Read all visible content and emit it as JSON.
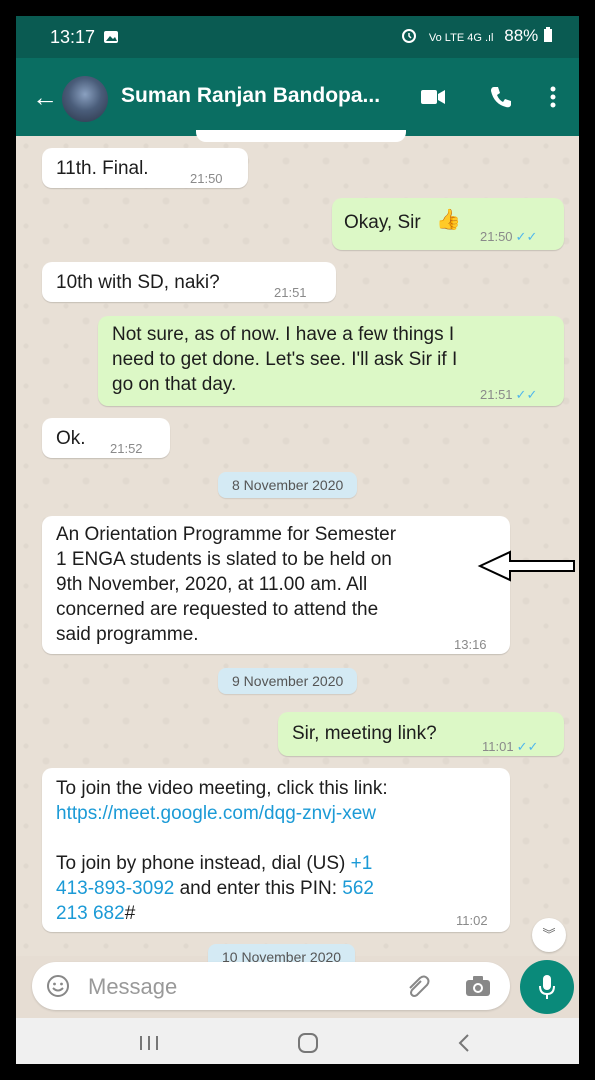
{
  "status": {
    "time": "13:17",
    "indicators": "88%",
    "image_icon": "image-icon"
  },
  "header": {
    "contact_name": "Suman Ranjan Bandopa...",
    "back_icon": "arrow-left-icon",
    "video_icon": "video-icon",
    "call_icon": "phone-icon",
    "menu_icon": "more-vert-icon"
  },
  "messages": [
    {
      "dir": "in",
      "text": "11th. Final.",
      "time": "21:50"
    },
    {
      "dir": "out",
      "text": "Okay, Sir",
      "emoji": "👍",
      "time": "21:50"
    },
    {
      "dir": "in",
      "text": "10th with SD, naki?",
      "time": "21:51"
    },
    {
      "dir": "out",
      "lines": [
        "Not sure, as of now. I have a few things I",
        "need to get done. Let's see. I'll ask Sir if I",
        "go on that day."
      ],
      "time": "21:51"
    },
    {
      "dir": "in",
      "text": "Ok.",
      "time": "21:52"
    },
    {
      "dir": "in",
      "lines": [
        "An Orientation Programme for Semester",
        "1 ENGA students is slated to be held on",
        "9th November, 2020, at 11.00 am. All",
        "concerned are requested to attend the",
        "said programme."
      ],
      "time": "13:16"
    },
    {
      "dir": "out",
      "text": "Sir, meeting link?",
      "time": "11:01"
    },
    {
      "dir": "in",
      "line1": "To join the video meeting, click this link:",
      "link": "https://meet.google.com/dqg-znvj-xew",
      "line3": "To join by phone instead, dial (US) ",
      "phone_a": "+1",
      "phone_b": "413-893-3092",
      "line4_mid": " and enter this PIN: ",
      "pin_a": "562",
      "pin_b": "213 682",
      "pin_hash": "#",
      "time": "11:02"
    }
  ],
  "dates": [
    "8 November 2020",
    "9 November 2020",
    "10 November 2020"
  ],
  "input": {
    "placeholder": "Message",
    "emoji_icon": "emoji-icon",
    "attach_icon": "attach-icon",
    "camera_icon": "camera-icon",
    "mic_icon": "mic-icon",
    "scroll_icon": "chevron-double-down-icon"
  },
  "nav": {
    "recents_icon": "recents-icon",
    "home_icon": "home-icon",
    "back_icon": "back-nav-icon"
  }
}
